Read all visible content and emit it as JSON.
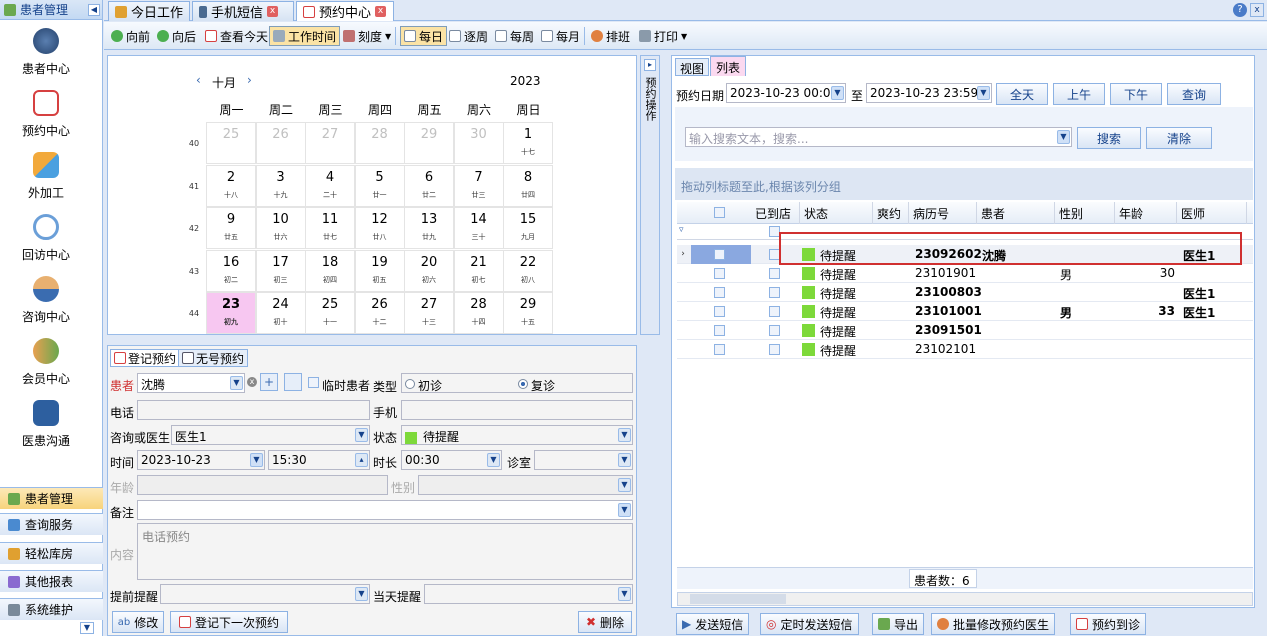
{
  "sidebar": {
    "header": "患者管理",
    "items": [
      {
        "label": "患者中心"
      },
      {
        "label": "预约中心"
      },
      {
        "label": "外加工"
      },
      {
        "label": "回访中心"
      },
      {
        "label": "咨询中心"
      },
      {
        "label": "会员中心"
      },
      {
        "label": "医患沟通"
      }
    ],
    "bottom": [
      {
        "label": "患者管理"
      },
      {
        "label": "查询服务"
      },
      {
        "label": "轻松库房"
      },
      {
        "label": "其他报表"
      },
      {
        "label": "系统维护"
      }
    ]
  },
  "tabs": [
    {
      "label": "今日工作"
    },
    {
      "label": "手机短信"
    },
    {
      "label": "预约中心"
    }
  ],
  "toolbar": {
    "forward": "向前",
    "back": "向后",
    "today": "查看今天",
    "worktime": "工作时间",
    "scale": "刻度",
    "daily": "每日",
    "weekly": "逐周",
    "perweek": "每周",
    "monthly": "每月",
    "schedule": "排班",
    "print": "打印"
  },
  "calendar": {
    "month": "十月",
    "year": "2023",
    "days": [
      "周一",
      "周二",
      "周三",
      "周四",
      "周五",
      "周六",
      "周日"
    ],
    "weeks": [
      {
        "num": "40",
        "cells": [
          {
            "d": "25",
            "s": ""
          },
          {
            "d": "26",
            "s": ""
          },
          {
            "d": "27",
            "s": ""
          },
          {
            "d": "28",
            "s": ""
          },
          {
            "d": "29",
            "s": ""
          },
          {
            "d": "30",
            "s": ""
          },
          {
            "d": "1",
            "s": "十七"
          }
        ]
      },
      {
        "num": "41",
        "cells": [
          {
            "d": "2",
            "s": "十八"
          },
          {
            "d": "3",
            "s": "十九"
          },
          {
            "d": "4",
            "s": "二十"
          },
          {
            "d": "5",
            "s": "廿一"
          },
          {
            "d": "6",
            "s": "廿二"
          },
          {
            "d": "7",
            "s": "廿三"
          },
          {
            "d": "8",
            "s": "廿四"
          }
        ]
      },
      {
        "num": "42",
        "cells": [
          {
            "d": "9",
            "s": "廿五"
          },
          {
            "d": "10",
            "s": "廿六"
          },
          {
            "d": "11",
            "s": "廿七"
          },
          {
            "d": "12",
            "s": "廿八"
          },
          {
            "d": "13",
            "s": "廿九"
          },
          {
            "d": "14",
            "s": "三十"
          },
          {
            "d": "15",
            "s": "九月"
          }
        ]
      },
      {
        "num": "43",
        "cells": [
          {
            "d": "16",
            "s": "初二"
          },
          {
            "d": "17",
            "s": "初三"
          },
          {
            "d": "18",
            "s": "初四"
          },
          {
            "d": "19",
            "s": "初五"
          },
          {
            "d": "20",
            "s": "初六"
          },
          {
            "d": "21",
            "s": "初七"
          },
          {
            "d": "22",
            "s": "初八"
          }
        ]
      },
      {
        "num": "44",
        "cells": [
          {
            "d": "23",
            "s": "初九"
          },
          {
            "d": "24",
            "s": "初十"
          },
          {
            "d": "25",
            "s": "十一"
          },
          {
            "d": "26",
            "s": "十二"
          },
          {
            "d": "27",
            "s": "十三"
          },
          {
            "d": "28",
            "s": "十四"
          },
          {
            "d": "29",
            "s": "十五"
          }
        ]
      }
    ],
    "side_tab": "预约操作"
  },
  "form": {
    "tab1": "登记预约",
    "tab2": "无号预约",
    "patient_label": "患者",
    "patient_value": "沈腾",
    "temp_patient": "临时患者",
    "type_label": "类型",
    "type_first": "初诊",
    "type_return": "复诊",
    "phone_label": "电话",
    "mobile_label": "手机",
    "doctor_label": "咨询或医生",
    "doctor_value": "医生1",
    "status_label": "状态",
    "status_value": "待提醒",
    "time_label": "时间",
    "date_value": "2023-10-23",
    "time_value": "15:30",
    "duration_label": "时长",
    "duration_value": "00:30",
    "room_label": "诊室",
    "age_label": "年龄",
    "gender_label": "性别",
    "note_label": "备注",
    "content_label": "内容",
    "content_value": "电话预约",
    "remind_label": "提前提醒",
    "dayremind_label": "当天提醒",
    "edit_button": "修改",
    "next_button": "登记下一次预约",
    "delete_button": "删除"
  },
  "right": {
    "tab_view": "视图",
    "tab_list": "列表",
    "date_label": "预约日期",
    "date_from": "2023-10-23 00:00",
    "to_label": "至",
    "date_to": "2023-10-23 23:59",
    "btn_all": "全天",
    "btn_am": "上午",
    "btn_pm": "下午",
    "btn_query": "查询",
    "search_placeholder": "输入搜索文本，搜索...",
    "btn_search": "搜索",
    "btn_clear": "清除",
    "group_hint": "拖动列标题至此,根据该列分组",
    "columns": [
      "已到店",
      "状态",
      "爽约",
      "病历号",
      "患者",
      "性别",
      "年龄",
      "医师"
    ],
    "rows": [
      {
        "status": "待提醒",
        "record": "23092602",
        "patient": "沈腾",
        "gender": "",
        "age": "",
        "doctor": "医生1"
      },
      {
        "status": "待提醒",
        "record": "23101901",
        "patient": "",
        "gender": "男",
        "age": "30",
        "doctor": ""
      },
      {
        "status": "待提醒",
        "record": "23100803",
        "patient": "",
        "gender": "",
        "age": "",
        "doctor": "医生1"
      },
      {
        "status": "待提醒",
        "record": "23101001",
        "patient": "",
        "gender": "男",
        "age": "33",
        "doctor": "医生1"
      },
      {
        "status": "待提醒",
        "record": "23091501",
        "patient": "",
        "gender": "",
        "age": "",
        "doctor": ""
      },
      {
        "status": "待提醒",
        "record": "23102101",
        "patient": "",
        "gender": "",
        "age": "",
        "doctor": ""
      }
    ],
    "count_label": "患者数：6",
    "bottom_buttons": [
      "发送短信",
      "定时发送短信",
      "导出",
      "批量修改预约医生",
      "预约到诊"
    ]
  }
}
